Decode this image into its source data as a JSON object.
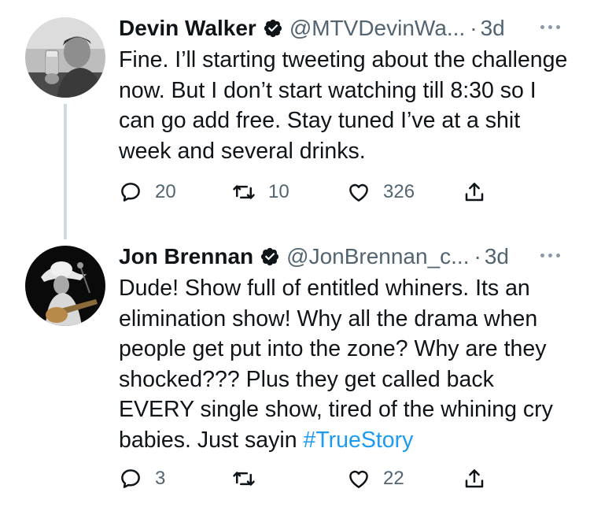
{
  "tweets": [
    {
      "name": "Devin Walker",
      "handle": "@MTVDevinWa...",
      "separator": "·",
      "time": "3d",
      "text": "Fine. I’ll starting tweeting about the challenge now. But I don’t start watching till 8:30 so I can go add free. Stay tuned I’ve at a shit week and several drinks.",
      "hashtag": "",
      "replies": "20",
      "retweets": "10",
      "likes": "326"
    },
    {
      "name": "Jon Brennan",
      "handle": "@JonBrennan_c...",
      "separator": "·",
      "time": "3d",
      "text": "Dude! Show full of entitled whiners.  Its an elimination show! Why all the drama when people get put into the zone?  Why are they shocked??? Plus they get called back EVERY single show, tired of the whining cry babies. Just sayin ",
      "hashtag": "#TrueStory",
      "replies": "3",
      "retweets": "",
      "likes": "22"
    }
  ],
  "icons": {
    "reply": "reply-icon",
    "retweet": "retweet-icon",
    "like": "heart-icon",
    "share": "share-icon",
    "verified": "verified-badge-icon",
    "more": "more-options-icon"
  },
  "colors": {
    "text": "#0f1419",
    "secondary": "#536471",
    "link": "#1d9bf0",
    "thread_line": "#cfd9de"
  }
}
